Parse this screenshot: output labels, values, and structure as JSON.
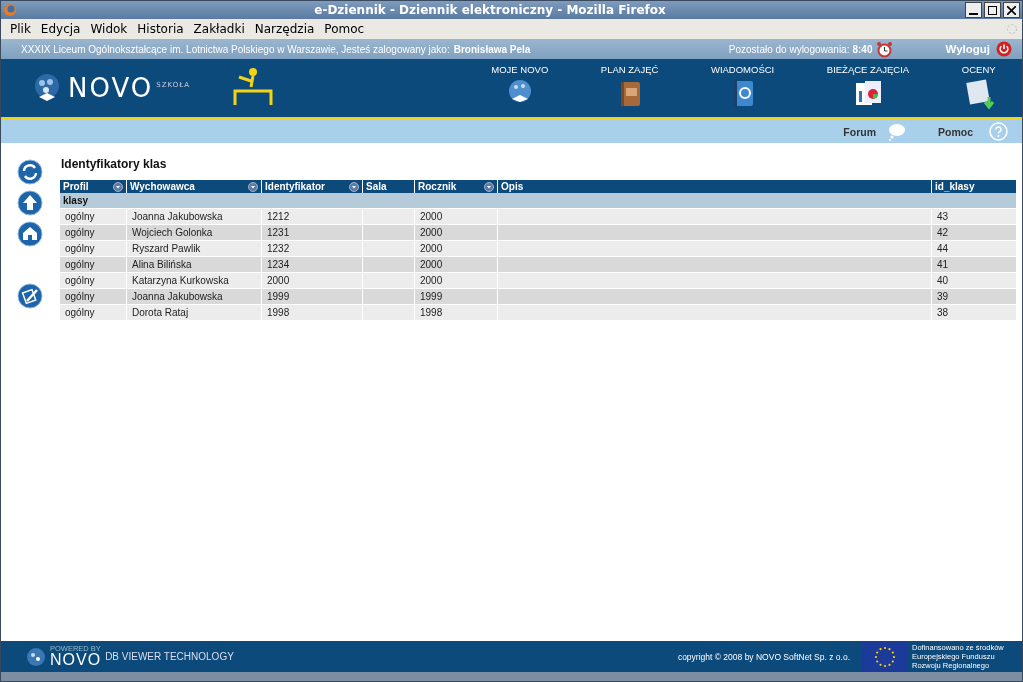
{
  "window": {
    "title": "e-Dziennik - Dziennik elektroniczny - Mozilla Firefox"
  },
  "menu": [
    "Plik",
    "Edycja",
    "Widok",
    "Historia",
    "Zakładki",
    "Narzędzia",
    "Pomoc"
  ],
  "info_bar": {
    "school": "XXXIX Liceum Ogólnokształcące im. Lotnictwa Polskiego w Warszawie, Jesteś zalogowany jako:",
    "user": "Bronisława Pela",
    "timer_label": "Pozostało do wylogowania:",
    "timer": "8:40",
    "logout": "Wyloguj"
  },
  "logo": {
    "name": "NOVO",
    "sub": "SZKOŁA"
  },
  "nav": [
    "MOJE NOVO",
    "PLAN ZAJĘĆ",
    "WIADOMOŚCI",
    "BIEŻĄCE ZAJĘCIA",
    "OCENY"
  ],
  "sub_bar": [
    "Forum",
    "Pomoc"
  ],
  "page_title": "Identyfikatory klas",
  "table": {
    "columns": [
      {
        "label": "Profil",
        "filter": true
      },
      {
        "label": "Wychowawca",
        "filter": true
      },
      {
        "label": "Identyfikator",
        "filter": true
      },
      {
        "label": "Sala",
        "filter": false
      },
      {
        "label": "Rocznik",
        "filter": true
      },
      {
        "label": "Opis",
        "filter": false
      },
      {
        "label": "id_klasy",
        "filter": false
      }
    ],
    "group": "klasy",
    "rows": [
      [
        "ogólny",
        "Joanna Jakubowska",
        "1212",
        "",
        "2000",
        "",
        "43"
      ],
      [
        "ogólny",
        "Wojciech Golonka",
        "1231",
        "",
        "2000",
        "",
        "42"
      ],
      [
        "ogólny",
        "Ryszard Pawlik",
        "1232",
        "",
        "2000",
        "",
        "44"
      ],
      [
        "ogólny",
        "Alina Bilińska",
        "1234",
        "",
        "2000",
        "",
        "41"
      ],
      [
        "ogólny",
        "Katarzyna Kurkowska",
        "2000",
        "",
        "2000",
        "",
        "40"
      ],
      [
        "ogólny",
        "Joanna Jakubowska",
        "1999",
        "",
        "1999",
        "",
        "39"
      ],
      [
        "ogólny",
        "Dorota Rataj",
        "1998",
        "",
        "1998",
        "",
        "38"
      ]
    ]
  },
  "footer": {
    "powered": "POWERED BY",
    "brand": "NOVO",
    "tech": "DB VIEWER TECHNOLOGY",
    "copyright": "copyright © 2008 by NOVO SoftNet Sp. z o.o.",
    "eu": "Dofinansowano ze środków Europejskiego Funduszu Rozwoju Regionalnego"
  }
}
